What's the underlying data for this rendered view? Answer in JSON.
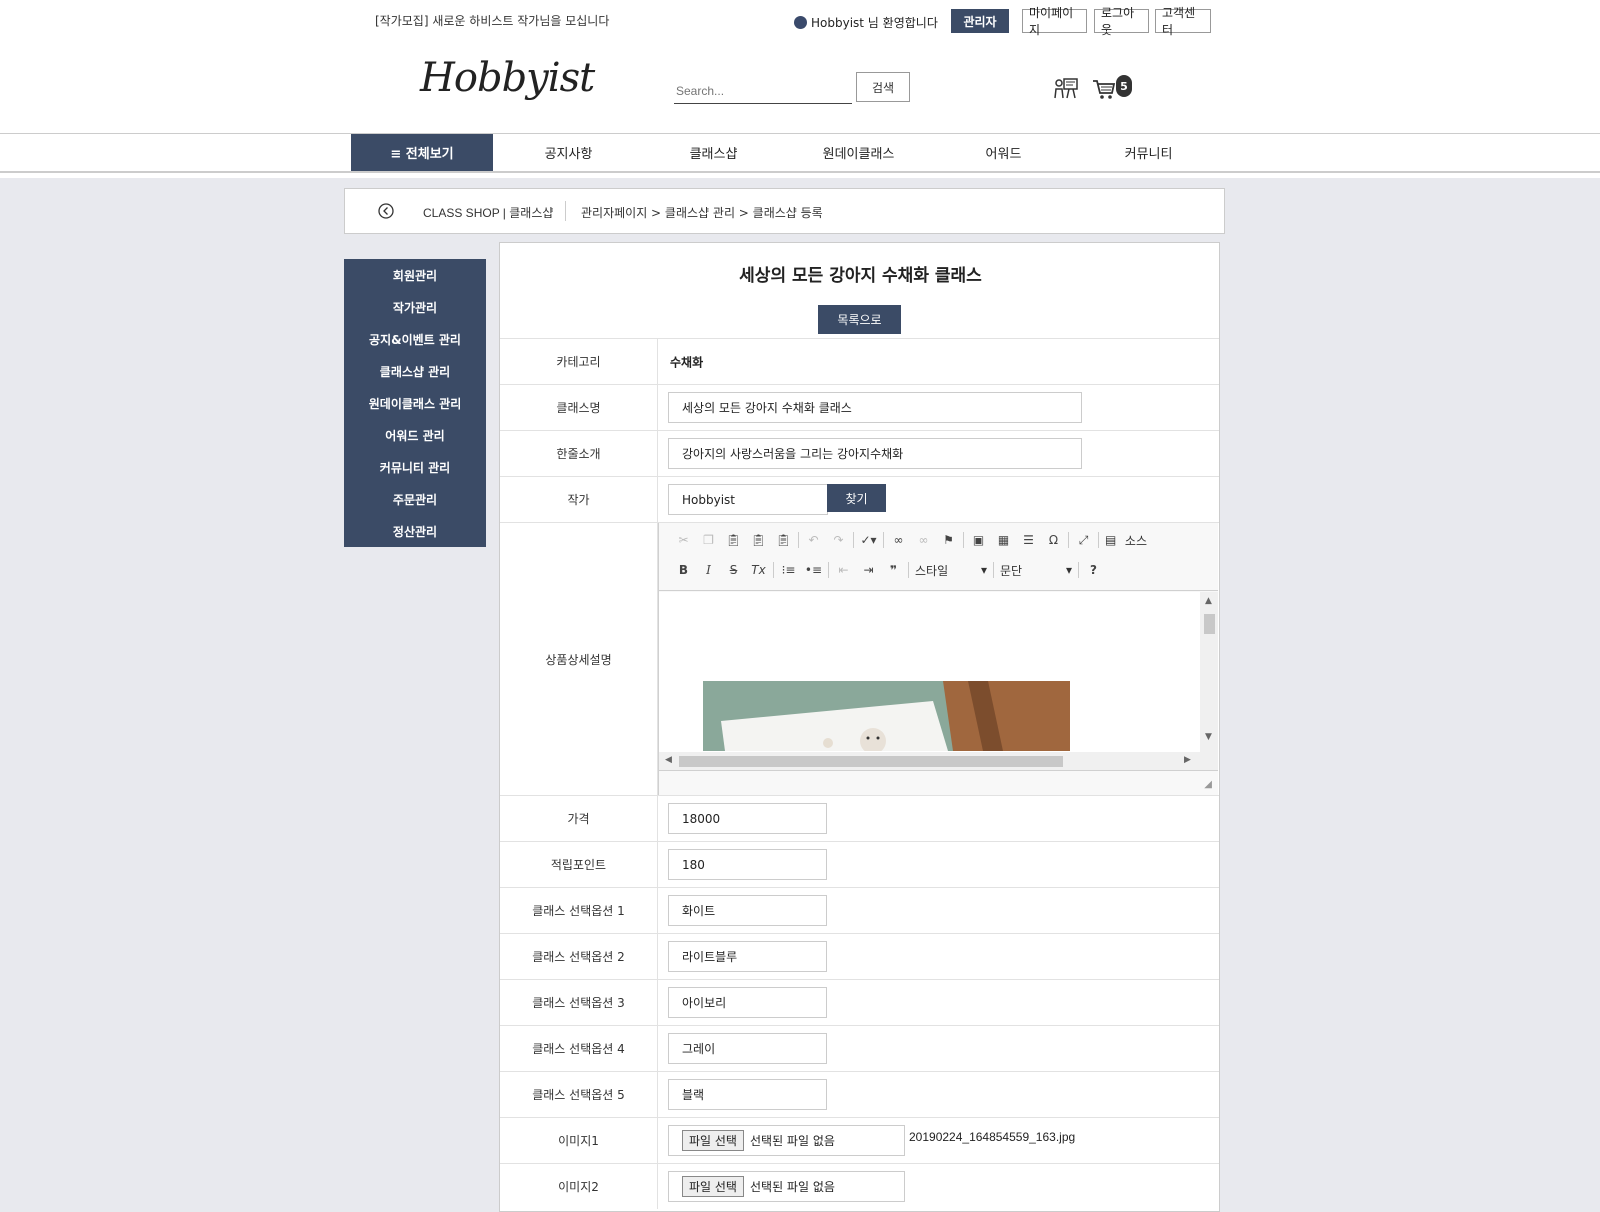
{
  "header": {
    "notice": "[작가모집] 새로운 하비스트 작가님을 모십니다",
    "welcome": "Hobbyist 님 환영합니다",
    "buttons": {
      "admin": "관리자",
      "mypage": "마이페이지",
      "logout": "로그아웃",
      "support": "고객센터"
    },
    "logo": "Hobbyist",
    "search": {
      "placeholder": "Search...",
      "button": "검색"
    },
    "cart_count": "5"
  },
  "nav": {
    "all": "≡ 전체보기",
    "items": [
      "공지사항",
      "클래스샵",
      "원데이클래스",
      "어워드",
      "커뮤니티"
    ]
  },
  "breadcrumb": {
    "shop": "CLASS SHOP | 클래스샵",
    "path": "관리자페이지 > 클래스샵 관리 > 클래스샵 등록"
  },
  "sidebar": {
    "items": [
      "회원관리",
      "작가관리",
      "공지&이벤트 관리",
      "클래스샵 관리",
      "원데이클래스 관리",
      "어워드 관리",
      "커뮤니티 관리",
      "주문관리",
      "정산관리"
    ]
  },
  "form": {
    "title": "세상의 모든 강아지 수채화 클래스",
    "list_button": "목록으로",
    "category": {
      "label": "카테고리",
      "value": "수채화"
    },
    "class_name": {
      "label": "클래스명",
      "value": "세상의 모든 강아지 수채화 클래스"
    },
    "intro": {
      "label": "한줄소개",
      "value": "강아지의 사랑스러움을 그리는 강아지수채화"
    },
    "artist": {
      "label": "작가",
      "value": "Hobbyist",
      "find": "찾기"
    },
    "detail": {
      "label": "상품상세설명",
      "style_combo": "스타일",
      "para_combo": "문단",
      "source": "소스"
    },
    "price": {
      "label": "가격",
      "value": "18000"
    },
    "points": {
      "label": "적립포인트",
      "value": "180"
    },
    "options": [
      {
        "label": "클래스 선택옵션 1",
        "value": "화이트"
      },
      {
        "label": "클래스 선택옵션 2",
        "value": "라이트블루"
      },
      {
        "label": "클래스 선택옵션 3",
        "value": "아이보리"
      },
      {
        "label": "클래스 선택옵션 4",
        "value": "그레이"
      },
      {
        "label": "클래스 선택옵션 5",
        "value": "블랙"
      }
    ],
    "image1": {
      "label": "이미지1",
      "choose": "파일 선택",
      "status": "선택된 파일 없음",
      "filename": "20190224_164854559_163.jpg"
    },
    "image2": {
      "label": "이미지2",
      "choose": "파일 선택",
      "status": "선택된 파일 없음"
    }
  },
  "colors": {
    "brand": "#3b4b66",
    "background": "#e8e9ee"
  }
}
